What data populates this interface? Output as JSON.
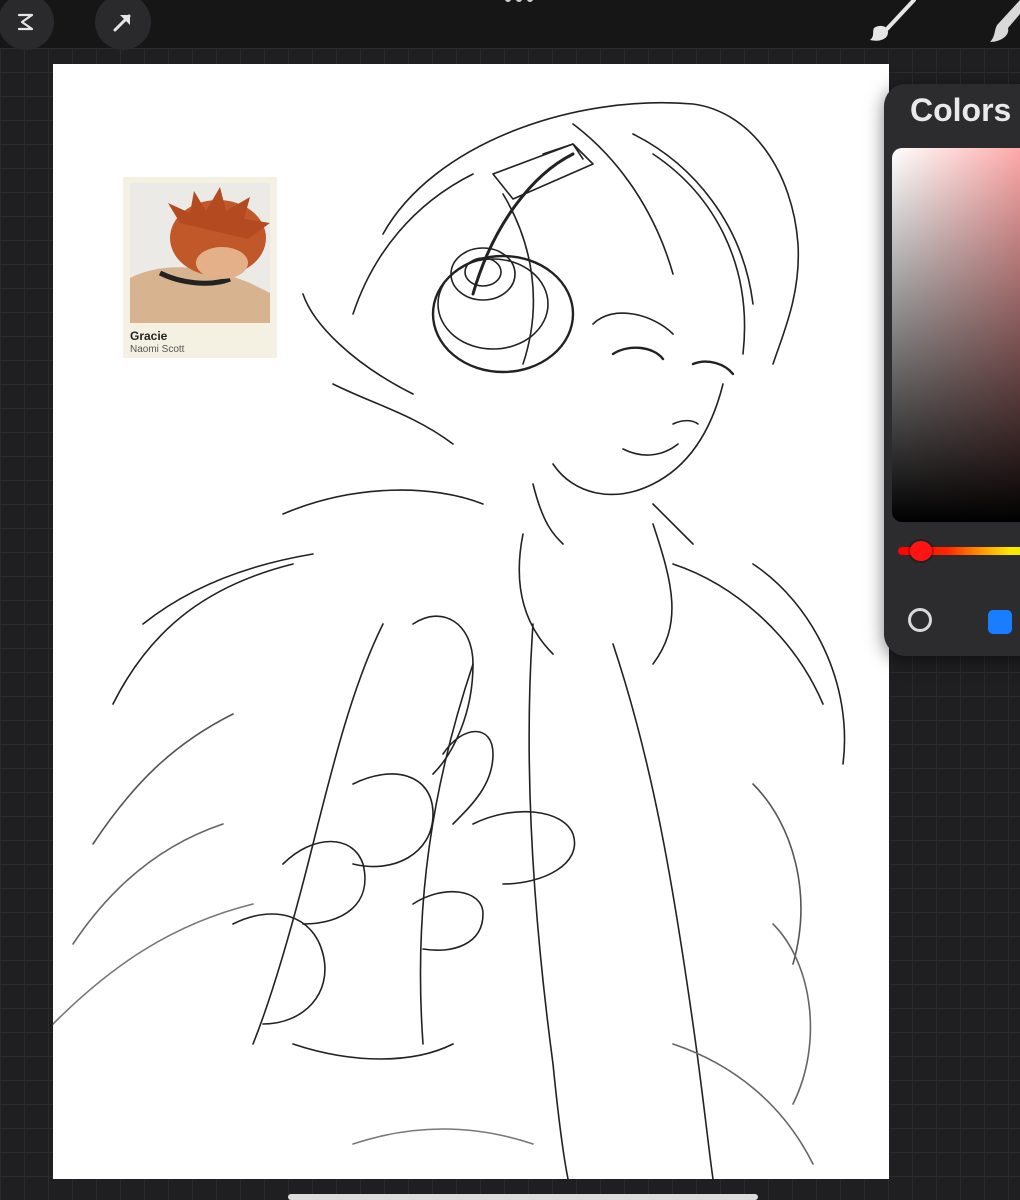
{
  "toolbar": {
    "left_icons": [
      "modify-icon",
      "selection-arrow-icon"
    ],
    "center_icon": "more-dots-icon",
    "right_icons": [
      "brush-icon",
      "smudge-icon"
    ]
  },
  "reference_card": {
    "name": "Gracie",
    "subtitle": "Naomi Scott"
  },
  "colors_panel": {
    "title": "Colors",
    "accent_color": "#1a7cff",
    "hue_color": "#ff1414",
    "modes": [
      "disc",
      "classic"
    ]
  }
}
